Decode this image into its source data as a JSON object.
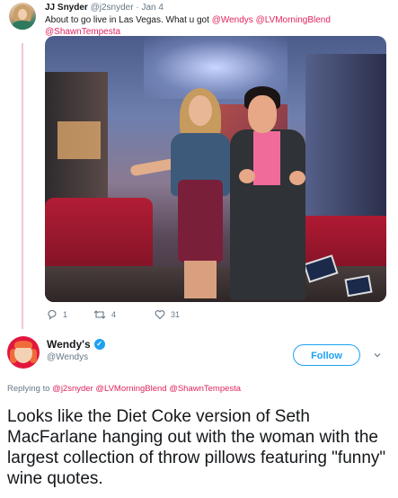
{
  "tweet1": {
    "author_name": "JJ Snyder",
    "author_handle": "@j2snyder",
    "separator": "·",
    "date": "Jan 4",
    "text_prefix": "About to go live in Las Vegas. What u got",
    "mention1": "@Wendys",
    "mention2": "@LVMorningBlend",
    "mention3": "@ShawnTempesta",
    "actions": {
      "reply_count": "1",
      "retweet_count": "4",
      "like_count": "31"
    }
  },
  "tweet2": {
    "author_name": "Wendy's",
    "author_handle": "@Wendys",
    "follow_label": "Follow",
    "reply_label": "Replying to",
    "reply_mention1": "@j2snyder",
    "reply_mention2": "@LVMorningBlend",
    "reply_mention3": "@ShawnTempesta",
    "text": "Looks like the Diet Coke version of Seth MacFarlane hanging out with the woman with the largest collection of throw pillows featuring \"funny\" wine quotes."
  },
  "colors": {
    "mention": "#e0245e",
    "follow_blue": "#1da1f2",
    "thread_line": "#f4c6cf",
    "muted": "#657786"
  },
  "icons": [
    "reply-icon",
    "retweet-icon",
    "like-icon",
    "verified-icon",
    "chevron-down-icon"
  ]
}
